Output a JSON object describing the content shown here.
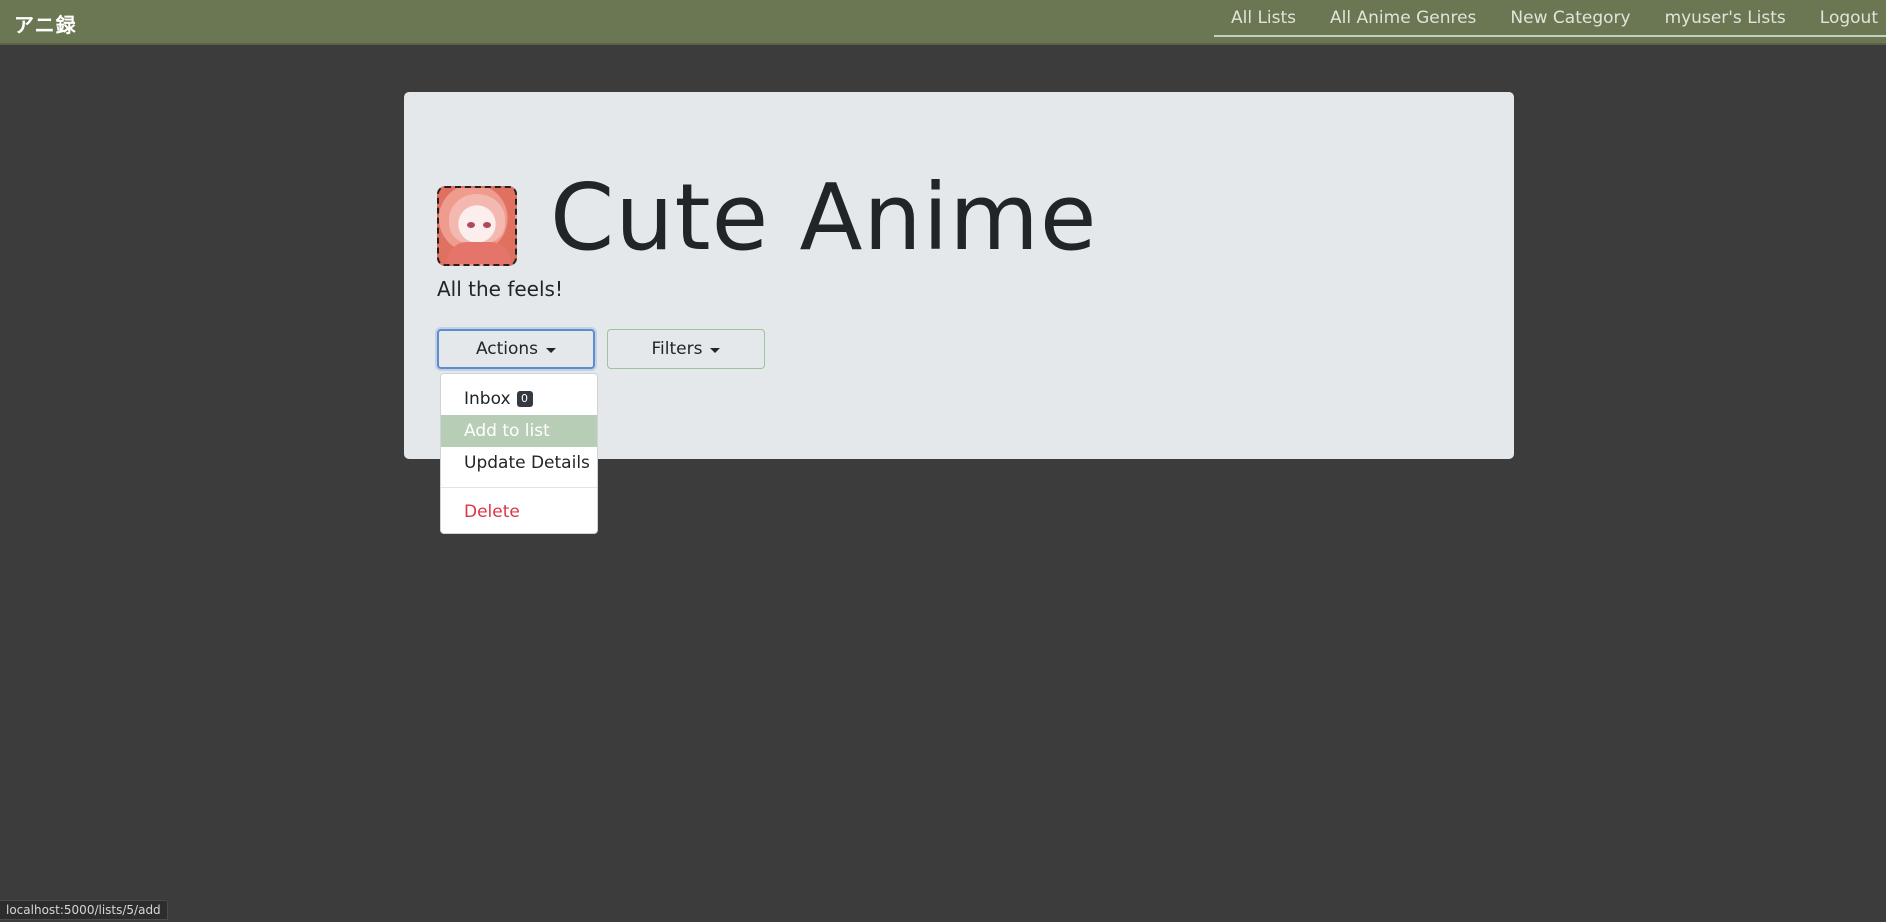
{
  "navbar": {
    "brand": "アニ録",
    "links": [
      "All Lists",
      "All Anime Genres",
      "New Category",
      "myuser's Lists",
      "Logout"
    ]
  },
  "list": {
    "title": "Cute Anime",
    "description": "All the feels!"
  },
  "buttons": {
    "actions": "Actions",
    "filters": "Filters"
  },
  "actions_menu": {
    "inbox_label": "Inbox",
    "inbox_count": "0",
    "add_to_list": "Add to list",
    "update_details": "Update Details",
    "delete": "Delete",
    "highlighted_item": "Add to list"
  },
  "status_bar": {
    "url": "localhost:5000/lists/5/add"
  },
  "colors": {
    "navbar": "#6b7752",
    "background": "#3c3c3c",
    "jumbotron": "#e4e8eb",
    "menu_highlight": "#b8cdb6",
    "danger": "#dc3545"
  }
}
